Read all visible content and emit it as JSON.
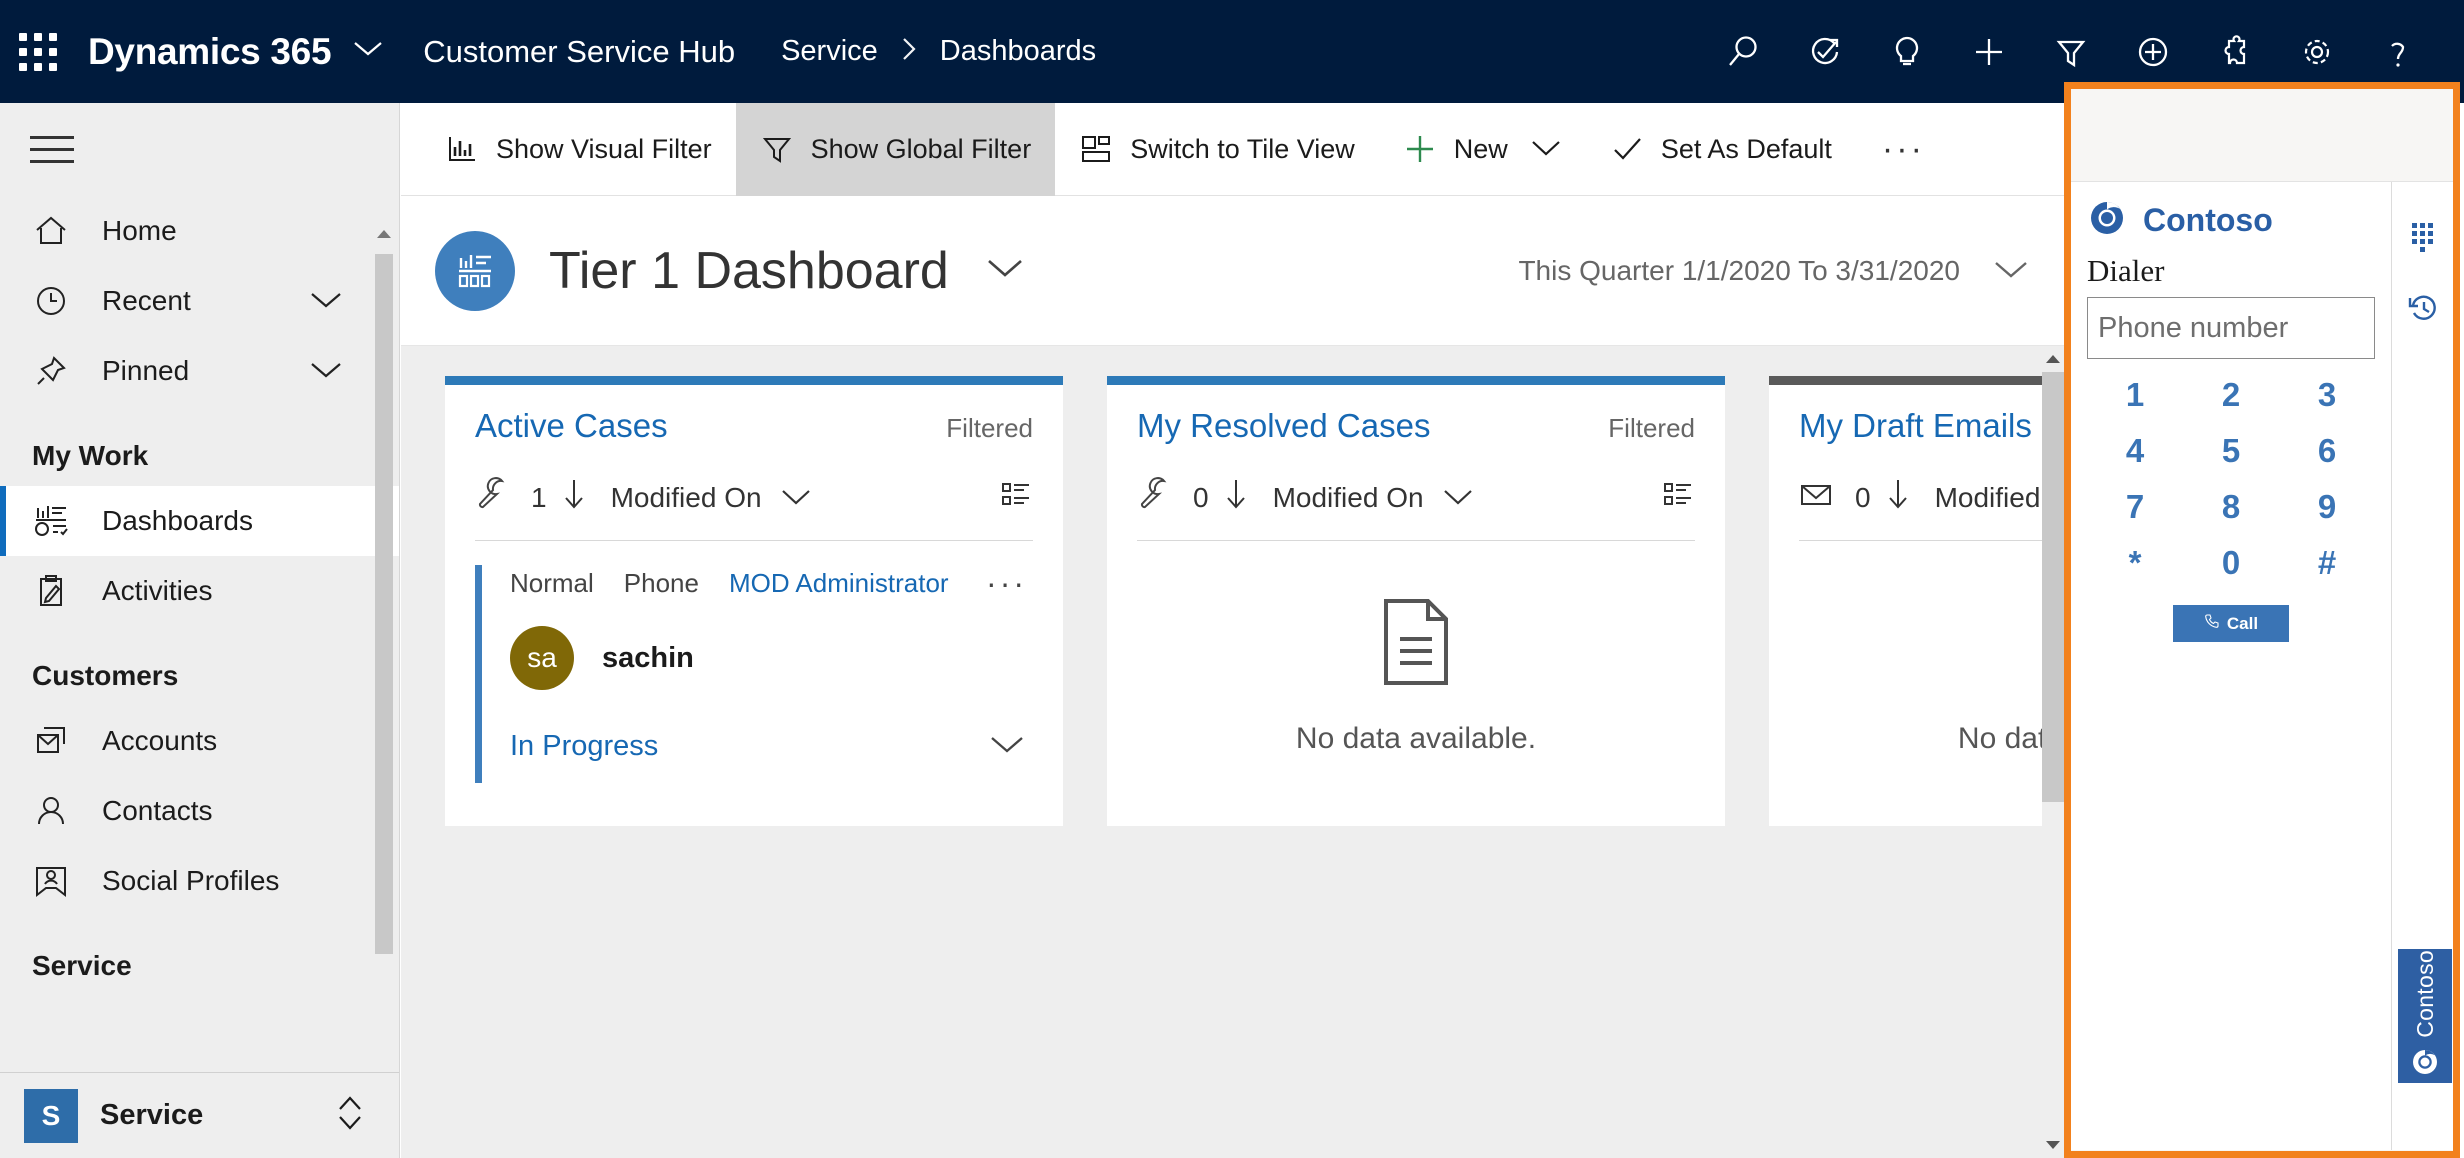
{
  "topbar": {
    "waffle_label": "App launcher",
    "brand": "Dynamics 365",
    "app_name": "Customer Service Hub",
    "breadcrumb": [
      "Service",
      "Dashboards"
    ],
    "breadcrumb_separator": "›",
    "icons": [
      {
        "name": "search-icon",
        "glyph": "search"
      },
      {
        "name": "assistant-icon",
        "glyph": "assistant"
      },
      {
        "name": "lightbulb-icon",
        "glyph": "bulb"
      },
      {
        "name": "plus-icon",
        "glyph": "plus"
      },
      {
        "name": "filter-icon",
        "glyph": "filter"
      },
      {
        "name": "quick-create-icon",
        "glyph": "plus-circle"
      },
      {
        "name": "puzzle-icon",
        "glyph": "puzzle"
      },
      {
        "name": "settings-gear-icon",
        "glyph": "gear"
      },
      {
        "name": "help-icon",
        "glyph": "question"
      }
    ]
  },
  "sidebar": {
    "hamburger_label": "Expand navigation",
    "top_items": [
      {
        "label": "Home",
        "icon": "home-icon",
        "chevron": false,
        "selected": false
      },
      {
        "label": "Recent",
        "icon": "clock-icon",
        "chevron": true,
        "selected": false
      },
      {
        "label": "Pinned",
        "icon": "pin-icon",
        "chevron": true,
        "selected": false
      }
    ],
    "groups": [
      {
        "title": "My Work",
        "items": [
          {
            "label": "Dashboards",
            "icon": "dashboard-icon",
            "selected": true
          },
          {
            "label": "Activities",
            "icon": "activities-icon",
            "selected": false
          }
        ]
      },
      {
        "title": "Customers",
        "items": [
          {
            "label": "Accounts",
            "icon": "accounts-icon",
            "selected": false
          },
          {
            "label": "Contacts",
            "icon": "contacts-icon",
            "selected": false
          },
          {
            "label": "Social Profiles",
            "icon": "social-profiles-icon",
            "selected": false
          }
        ]
      },
      {
        "title": "Service",
        "items": []
      }
    ],
    "app_switcher": {
      "initial": "S",
      "label": "Service"
    }
  },
  "command_bar": {
    "items": [
      {
        "label": "Show Visual Filter",
        "icon": "bar-chart-icon",
        "pressed": false,
        "caret": false
      },
      {
        "label": "Show Global Filter",
        "icon": "filter-icon",
        "pressed": true,
        "caret": false
      },
      {
        "label": "Switch to Tile View",
        "icon": "tile-view-icon",
        "pressed": false,
        "caret": false
      },
      {
        "label": "New",
        "icon": "plus-green-icon",
        "pressed": false,
        "caret": true
      },
      {
        "label": "Set As Default",
        "icon": "check-icon",
        "pressed": false,
        "caret": false
      }
    ],
    "overflow_label": "···"
  },
  "dashboard": {
    "icon_name": "dashboard-badge-icon",
    "title": "Tier 1 Dashboard",
    "title_caret": "chevron-down-icon",
    "date_range": "This Quarter 1/1/2020 To 3/31/2020",
    "date_caret": "chevron-down-icon"
  },
  "cards": [
    {
      "title": "Active Cases",
      "filtered_label": "Filtered",
      "accent": "#2d7ab8",
      "entity_icon": "wrench-icon",
      "count": "1",
      "sort_direction_icon": "arrow-down-icon",
      "sort_field": "Modified On",
      "list_icon": "list-view-icon",
      "empty": false,
      "record": {
        "priority": "Normal",
        "origin": "Phone",
        "owner": "MOD Administrator",
        "overflow": "···",
        "avatar_initials": "sa",
        "avatar_color": "#806807",
        "name": "sachin",
        "status": "In Progress",
        "status_caret": "chevron-down-icon"
      }
    },
    {
      "title": "My Resolved Cases",
      "filtered_label": "Filtered",
      "accent": "#2d7ab8",
      "entity_icon": "wrench-icon",
      "count": "0",
      "sort_direction_icon": "arrow-down-icon",
      "sort_field": "Modified On",
      "list_icon": "list-view-icon",
      "empty": true,
      "empty_icon": "document-icon",
      "empty_text": "No data available."
    },
    {
      "title": "My Draft Emails",
      "filtered_label": "",
      "accent": "#5a5a5a",
      "entity_icon": "envelope-icon",
      "count": "0",
      "sort_direction_icon": "arrow-down-icon",
      "sort_field": "Modified On",
      "list_icon": "list-view-icon",
      "empty": true,
      "empty_icon": "document-icon",
      "empty_text": "No data available."
    }
  ],
  "panel": {
    "highlight_color": "#f2811d",
    "provider_name": "Contoso",
    "provider_logo": "contoso-swirl-icon",
    "dialer_label": "Dialer",
    "phone_placeholder": "Phone number",
    "phone_value": "",
    "keys": [
      "1",
      "2",
      "3",
      "4",
      "5",
      "6",
      "7",
      "8",
      "9",
      "*",
      "0",
      "#"
    ],
    "call_label": "Call",
    "call_icon": "phone-icon",
    "rail": [
      {
        "name": "dialpad-icon"
      },
      {
        "name": "call-history-icon"
      }
    ],
    "side_tab": {
      "label": "Contoso",
      "icon": "contoso-swirl-icon"
    }
  }
}
